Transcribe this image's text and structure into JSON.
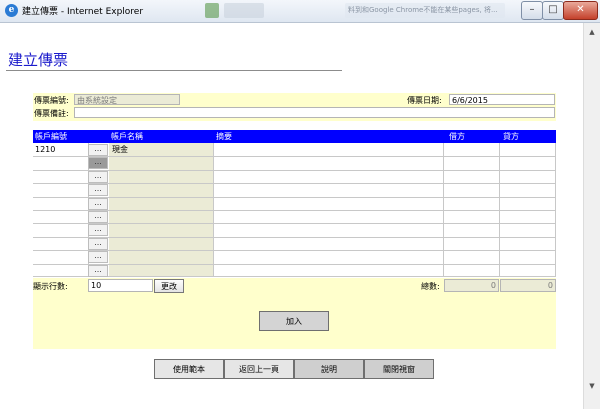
{
  "window": {
    "title": "建立傳票 - Internet Explorer",
    "background_text": "料到和Google Chrome不能在某些pages,  将...ascm..."
  },
  "page": {
    "title": "建立傳票"
  },
  "header_form": {
    "voucher_no_label": "傳票編號:",
    "voucher_no_value": "由系統設定",
    "voucher_date_label": "傳票日期:",
    "voucher_date_value": "6/6/2015",
    "remark_label": "傳票備註:",
    "remark_value": ""
  },
  "grid": {
    "columns": [
      "帳戶編號",
      "帳戶名稱",
      "摘要",
      "借方",
      "貸方"
    ],
    "browse_label": "...",
    "rows": [
      {
        "account_no": "1210",
        "account_name": "現金"
      },
      {
        "account_no": "",
        "account_name": ""
      },
      {
        "account_no": "",
        "account_name": ""
      },
      {
        "account_no": "",
        "account_name": ""
      },
      {
        "account_no": "",
        "account_name": ""
      },
      {
        "account_no": "",
        "account_name": ""
      },
      {
        "account_no": "",
        "account_name": ""
      },
      {
        "account_no": "",
        "account_name": ""
      },
      {
        "account_no": "",
        "account_name": ""
      },
      {
        "account_no": "",
        "account_name": ""
      }
    ]
  },
  "footer": {
    "rows_label": "顯示行數:",
    "rows_value": "10",
    "change_button": "更改",
    "total_label": "總數:",
    "total_debit": "0",
    "total_credit": "0",
    "add_button": "加入"
  },
  "bottom_buttons": {
    "use_template": "使用範本",
    "back": "返回上一頁",
    "help": "說明",
    "close_window": "關閉視窗"
  },
  "icons": [
    "ie-icon",
    "minimize-icon",
    "maximize-icon",
    "close-icon",
    "scroll-up-icon",
    "scroll-down-icon"
  ],
  "colors": {
    "header_blue": "#0000ff",
    "panel_yellow": "#ffffcc",
    "title_blue": "#1b1bcc",
    "readonly_bg": "#ebebd6"
  }
}
